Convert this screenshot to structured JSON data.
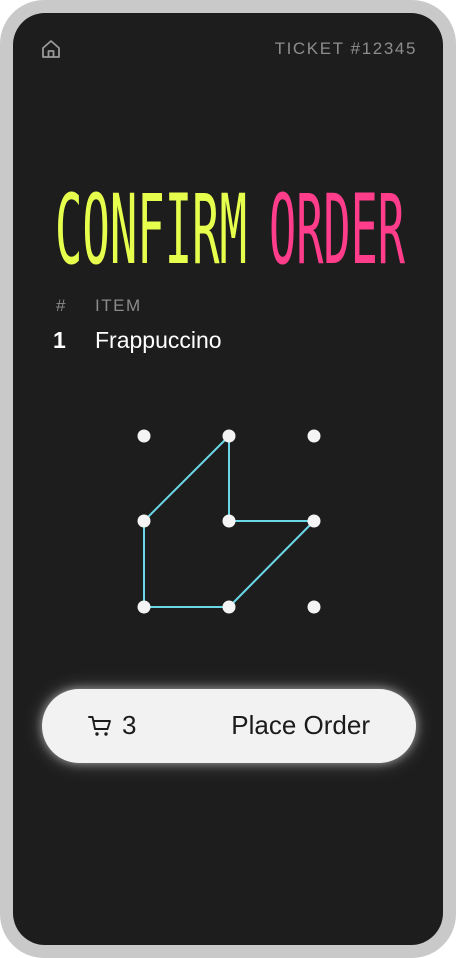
{
  "header": {
    "ticket": "TICKET #12345",
    "home_icon": "home-icon"
  },
  "title": {
    "confirm": "CONFIRM",
    "order": "ORDER",
    "confirm_color": "#e6ff4d",
    "order_color": "#ff3d8b"
  },
  "table": {
    "headers": [
      "#",
      "ITEM"
    ],
    "rows": [
      {
        "number": "1",
        "item": "Frappuccino"
      }
    ]
  },
  "pattern_lock": {
    "grid": "3x3",
    "line_color": "#6ad8e6",
    "path": [
      4,
      2,
      5,
      6,
      8,
      7,
      4
    ]
  },
  "order_button": {
    "cart_icon": "cart-icon",
    "cart_count": "3",
    "label": "Place Order"
  }
}
